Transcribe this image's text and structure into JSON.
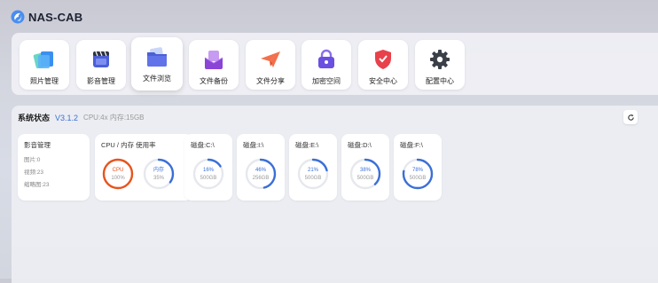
{
  "app": {
    "title": "NAS-CAB"
  },
  "apps": [
    {
      "label": "照片管理",
      "icon": "photo-icon"
    },
    {
      "label": "影音管理",
      "icon": "video-icon"
    },
    {
      "label": "文件浏览",
      "icon": "folder-icon"
    },
    {
      "label": "文件备份",
      "icon": "backup-icon"
    },
    {
      "label": "文件分享",
      "icon": "share-icon"
    },
    {
      "label": "加密空间",
      "icon": "lock-icon"
    },
    {
      "label": "安全中心",
      "icon": "shield-icon"
    },
    {
      "label": "配置中心",
      "icon": "gear-icon"
    }
  ],
  "status": {
    "title": "系统状态",
    "version": "V3.1.2",
    "sysinfo": "CPU:4x 内存:15GB",
    "media": {
      "title": "影音管理",
      "lines": [
        "图片:0",
        "视频:23",
        "缩略图:23"
      ]
    },
    "cpu_mem": {
      "title": "CPU / 内存 使用率",
      "cpu": {
        "name": "CPU",
        "value": "100%",
        "fraction": 1.0,
        "color": "#e8541c"
      },
      "mem": {
        "name": "内存",
        "value": "35%",
        "fraction": 0.35,
        "color": "#3b6fd8"
      }
    },
    "disks": [
      {
        "title": "磁盘:C:\\",
        "percent": "16%",
        "size": "500GB",
        "fraction": 0.16
      },
      {
        "title": "磁盘:I:\\",
        "percent": "46%",
        "size": "256GB",
        "fraction": 0.46
      },
      {
        "title": "磁盘:E:\\",
        "percent": "21%",
        "size": "500GB",
        "fraction": 0.21
      },
      {
        "title": "磁盘:D:\\",
        "percent": "38%",
        "size": "500GB",
        "fraction": 0.38
      },
      {
        "title": "磁盘:F:\\",
        "percent": "78%",
        "size": "500GB",
        "fraction": 0.78
      }
    ]
  },
  "colors": {
    "accent": "#3b6fd8",
    "cpu": "#e8541c",
    "track": "#e6e8ee"
  }
}
